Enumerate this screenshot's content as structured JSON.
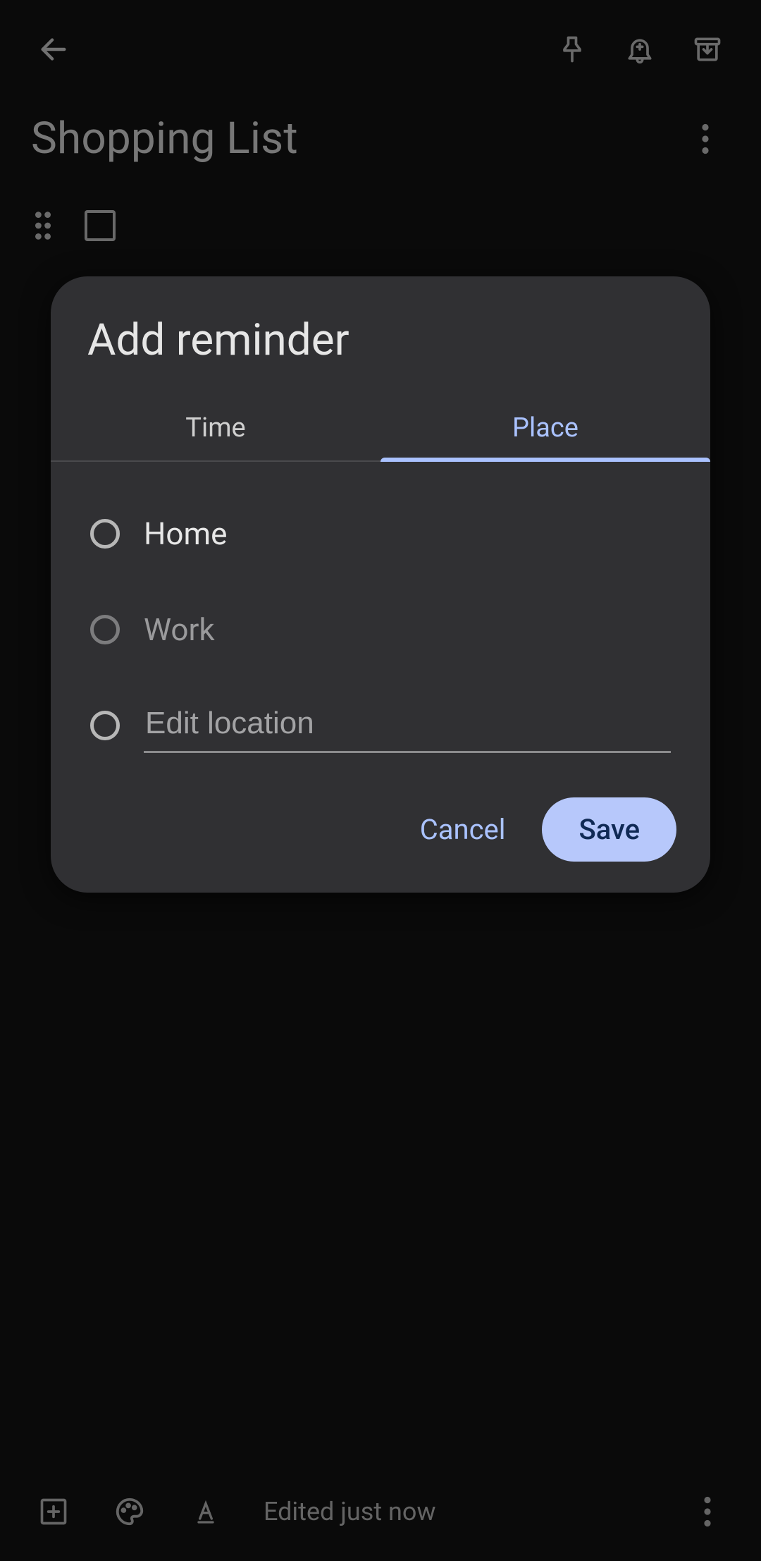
{
  "note": {
    "title": "Shopping List"
  },
  "footer": {
    "edited": "Edited just now"
  },
  "dialog": {
    "title": "Add reminder",
    "tabs": {
      "time": "Time",
      "place": "Place",
      "active": "place"
    },
    "options": {
      "home": "Home",
      "work": "Work",
      "edit_placeholder": "Edit location",
      "edit_value": ""
    },
    "actions": {
      "cancel": "Cancel",
      "save": "Save"
    }
  },
  "colors": {
    "accent": "#aac2ff",
    "accent_fill": "#b7c8fb",
    "dialog_bg": "#303033"
  }
}
